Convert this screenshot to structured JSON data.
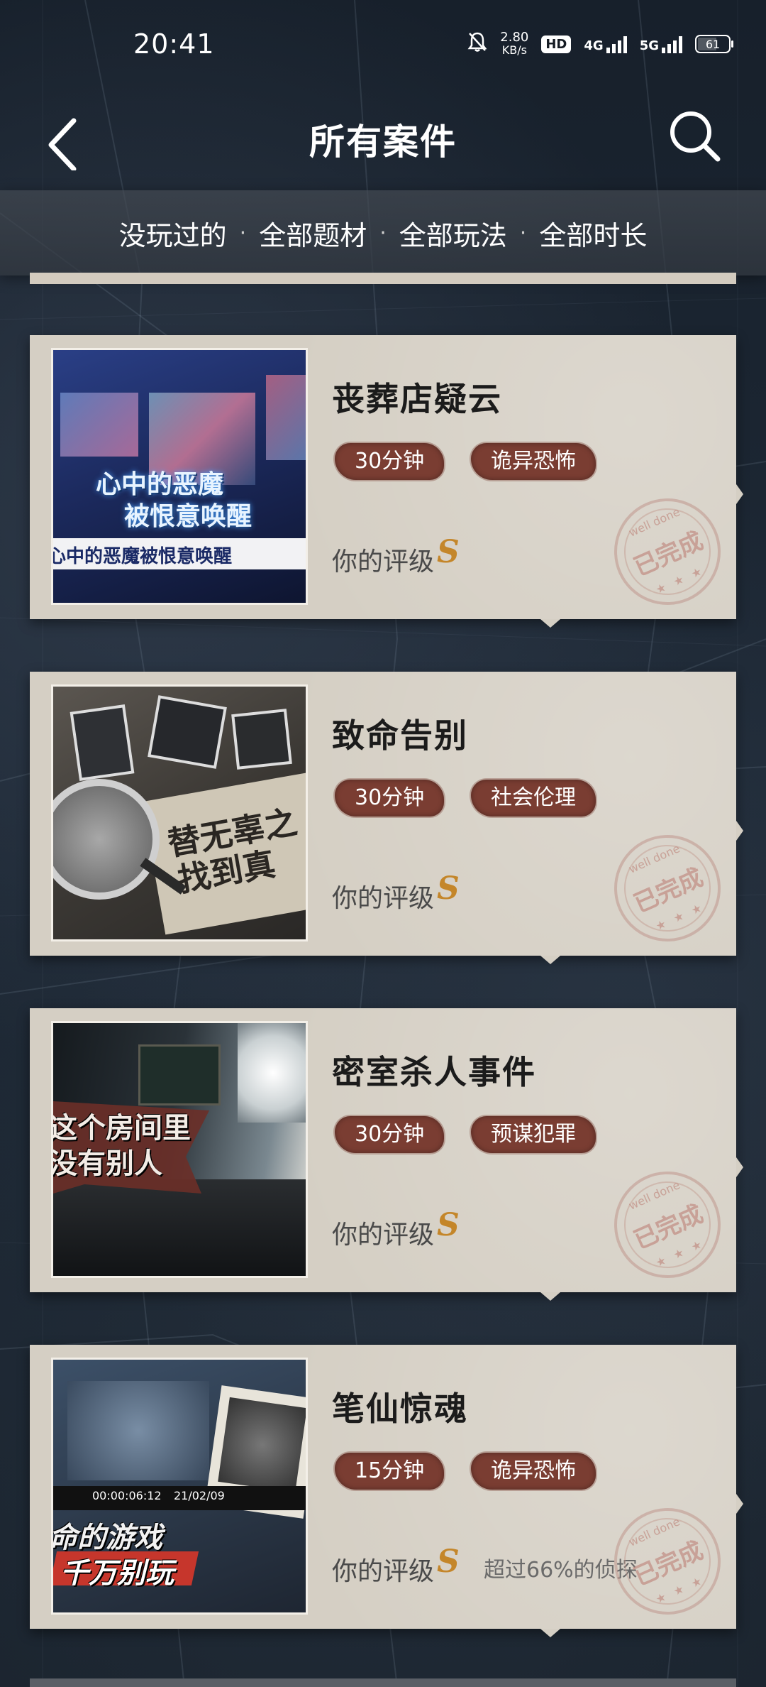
{
  "status_bar": {
    "time": "20:41",
    "net_speed_value": "2.80",
    "net_speed_unit": "KB/s",
    "hd_label": "HD",
    "signal_1": "4G",
    "signal_2": "5G",
    "battery": "61"
  },
  "header": {
    "title": "所有案件"
  },
  "filters": {
    "played": "没玩过的",
    "theme": "全部题材",
    "gameplay": "全部玩法",
    "duration": "全部时长",
    "separator": "·"
  },
  "cases": [
    {
      "title": "丧葬店疑云",
      "duration": "30分钟",
      "genre": "诡异恐怖",
      "rating_label": "你的评级",
      "rating": "S",
      "extra": "",
      "thumb_lines": [
        "心中的恶魔",
        "被恨意唤醒",
        "心中的恶魔被恨意唤醒"
      ],
      "stamp": "已完成",
      "stamp_top": "well done"
    },
    {
      "title": "致命告别",
      "duration": "30分钟",
      "genre": "社会伦理",
      "rating_label": "你的评级",
      "rating": "S",
      "extra": "",
      "thumb_lines": [
        "替无辜之",
        "找到真"
      ],
      "stamp": "已完成",
      "stamp_top": "well done"
    },
    {
      "title": "密室杀人事件",
      "duration": "30分钟",
      "genre": "预谋犯罪",
      "rating_label": "你的评级",
      "rating": "S",
      "extra": "",
      "thumb_lines": [
        "这个房间里",
        "没有别人"
      ],
      "stamp": "已完成",
      "stamp_top": "well done"
    },
    {
      "title": "笔仙惊魂",
      "duration": "15分钟",
      "genre": "诡异恐怖",
      "rating_label": "你的评级",
      "rating": "S",
      "extra": "超过66%的侦探",
      "thumb_lines": [
        "命的游戏",
        "千万别玩",
        "00:00:06:12",
        "21/02/09"
      ],
      "stamp": "已完成",
      "stamp_top": "well done"
    }
  ],
  "colors": {
    "background": "#141a22",
    "card": "#d5cfc4",
    "tag": "#7a3d32",
    "rating": "#c4862a"
  }
}
